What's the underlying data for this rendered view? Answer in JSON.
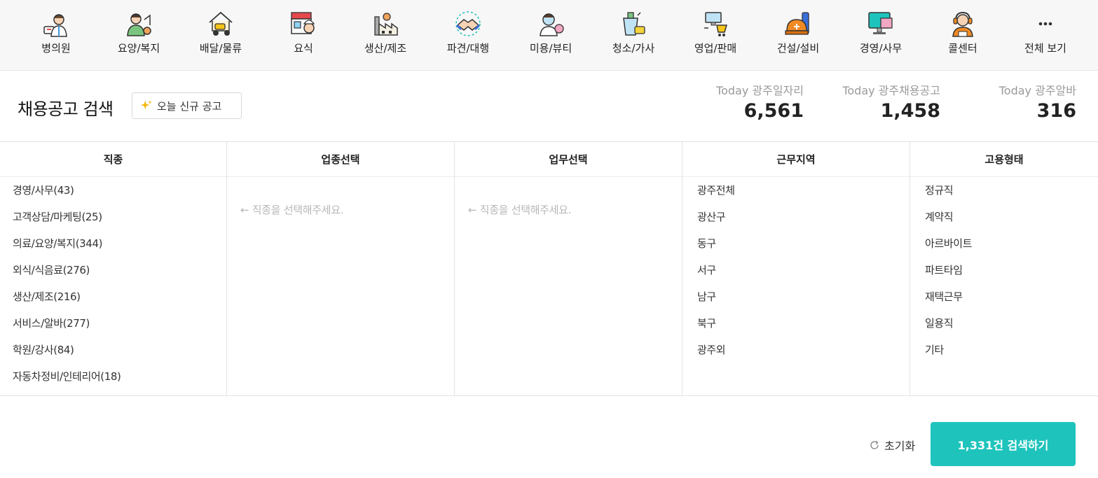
{
  "categories": [
    {
      "label": "병의원",
      "icon": "doctor-icon"
    },
    {
      "label": "요양/복지",
      "icon": "caregiver-icon"
    },
    {
      "label": "배달/물류",
      "icon": "delivery-scooter-icon"
    },
    {
      "label": "요식",
      "icon": "restaurant-chef-icon"
    },
    {
      "label": "생산/제조",
      "icon": "factory-icon"
    },
    {
      "label": "파견/대행",
      "icon": "handshake-icon"
    },
    {
      "label": "미용/뷰티",
      "icon": "beauty-icon"
    },
    {
      "label": "청소/가사",
      "icon": "cleaning-bucket-icon"
    },
    {
      "label": "영업/판매",
      "icon": "sales-cart-icon"
    },
    {
      "label": "건설/설비",
      "icon": "construction-helmet-icon"
    },
    {
      "label": "경영/사무",
      "icon": "office-monitor-icon"
    },
    {
      "label": "콜센터",
      "icon": "call-center-headset-icon"
    },
    {
      "label": "전체 보기",
      "icon": "more-dots-icon"
    }
  ],
  "header": {
    "title": "채용공고 검색",
    "new_button": "오늘 신규 공고"
  },
  "stats": [
    {
      "label": "Today 광주일자리",
      "value": "6,561"
    },
    {
      "label": "Today 광주채용공고",
      "value": "1,458"
    },
    {
      "label": "Today 광주알바",
      "value": "316"
    }
  ],
  "columns": {
    "job_type": {
      "title": "직종",
      "items": [
        "경영/사무(43)",
        "고객상담/마케팅(25)",
        "의료/요양/복지(344)",
        "외식/식음료(276)",
        "생산/제조(216)",
        "서비스/알바(277)",
        "학원/강사(84)",
        "자동차정비/인테리어(18)"
      ]
    },
    "industry": {
      "title": "업종선택",
      "hint": "← 직종을 선택해주세요."
    },
    "duty": {
      "title": "업무선택",
      "hint": "← 직종을 선택해주세요."
    },
    "region": {
      "title": "근무지역",
      "items": [
        "광주전체",
        "광산구",
        "동구",
        "서구",
        "남구",
        "북구",
        "광주외"
      ]
    },
    "employment": {
      "title": "고용형태",
      "items": [
        "정규직",
        "계약직",
        "아르바이트",
        "파트타임",
        "재택근무",
        "일용직",
        "기타"
      ]
    }
  },
  "footer": {
    "reset_label": "초기화",
    "search_label": "1,331건 검색하기"
  },
  "colors": {
    "accent": "#1ec4bc",
    "spark": "#f5b400"
  }
}
